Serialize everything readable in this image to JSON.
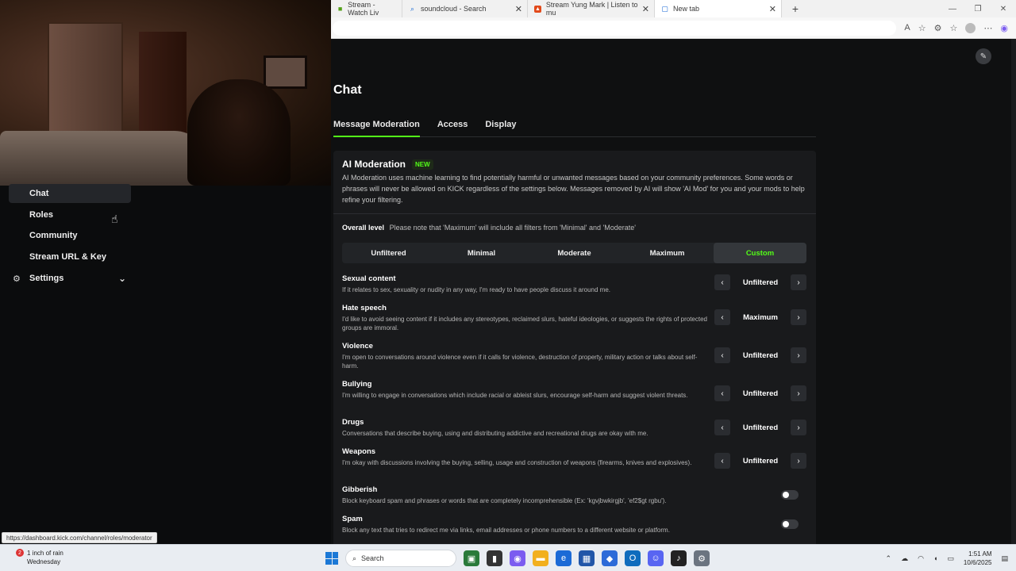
{
  "browser": {
    "tabs": [
      {
        "label": "Stream - Watch Liv",
        "icon": "kick-icon"
      },
      {
        "label": "soundcloud - Search",
        "icon": "search-icon"
      },
      {
        "label": "Stream Yung Mark | Listen to mu",
        "icon": "soundcloud-icon"
      },
      {
        "label": "New tab",
        "icon": "page-icon"
      }
    ],
    "new_tab_glyph": "+"
  },
  "sidebar": {
    "items": [
      {
        "label": "Chat",
        "selected": true
      },
      {
        "label": "Roles"
      },
      {
        "label": "Community"
      },
      {
        "label": "Stream URL & Key"
      },
      {
        "label": "Settings",
        "icon": "gear-icon",
        "expandable": true
      }
    ]
  },
  "status_url": "https://dashboard.kick.com/channel/roles/moderator",
  "page": {
    "title": "Chat",
    "tabs": [
      {
        "label": "Message Moderation",
        "active": true
      },
      {
        "label": "Access"
      },
      {
        "label": "Display"
      }
    ]
  },
  "ai": {
    "title": "AI Moderation",
    "badge": "NEW",
    "description": "AI Moderation uses machine learning to find potentially harmful or unwanted messages based on your community preferences. Some words or phrases will never be allowed on KICK regardless of the settings below. Messages removed by AI will show 'AI Mod' for you and your mods to help refine your filtering.",
    "overall_label": "Overall level",
    "overall_note": "Please note that 'Maximum' will include all filters from 'Minimal' and 'Moderate'",
    "levels": [
      "Unfiltered",
      "Minimal",
      "Moderate",
      "Maximum",
      "Custom"
    ],
    "active_level": "Custom",
    "categories": [
      {
        "name": "Sexual content",
        "desc": "If it relates to sex, sexuality or nudity in any way, I'm ready to have people discuss it around me.",
        "value": "Unfiltered"
      },
      {
        "name": "Hate speech",
        "desc": "I'd like to avoid seeing content if it includes any stereotypes, reclaimed slurs, hateful ideologies, or suggests the rights of protected groups are immoral.",
        "value": "Maximum"
      },
      {
        "name": "Violence",
        "desc": "I'm open to conversations around violence even if it calls for violence, destruction of property, military action or talks about self-harm.",
        "value": "Unfiltered"
      },
      {
        "name": "Bullying",
        "desc": "I'm willing to engage in conversations which include racial or ableist slurs, encourage self-harm and suggest violent threats.",
        "value": "Unfiltered"
      },
      {
        "name": "Drugs",
        "desc": "Conversations that describe buying, using and distributing addictive and recreational drugs are okay with me.",
        "value": "Unfiltered"
      },
      {
        "name": "Weapons",
        "desc": "I'm okay with discussions involving the buying, selling, usage and construction of weapons (firearms, knives and explosives).",
        "value": "Unfiltered"
      }
    ],
    "toggles": [
      {
        "name": "Gibberish",
        "desc": "Block keyboard spam and phrases or words that are completely incomprehensible (Ex: 'kgvjbwkirgjb', 'ef2$gt rgbu').",
        "on": false
      },
      {
        "name": "Spam",
        "desc": "Block any text that tries to redirect me via links, email addresses or phone numbers to a different website or platform.",
        "on": false
      }
    ]
  },
  "taskbar": {
    "weather_badge": "2",
    "weather_line1": "1 inch of rain",
    "weather_line2": "Wednesday",
    "search_placeholder": "Search",
    "time": "1:51 AM",
    "date": "10/6/2025"
  }
}
